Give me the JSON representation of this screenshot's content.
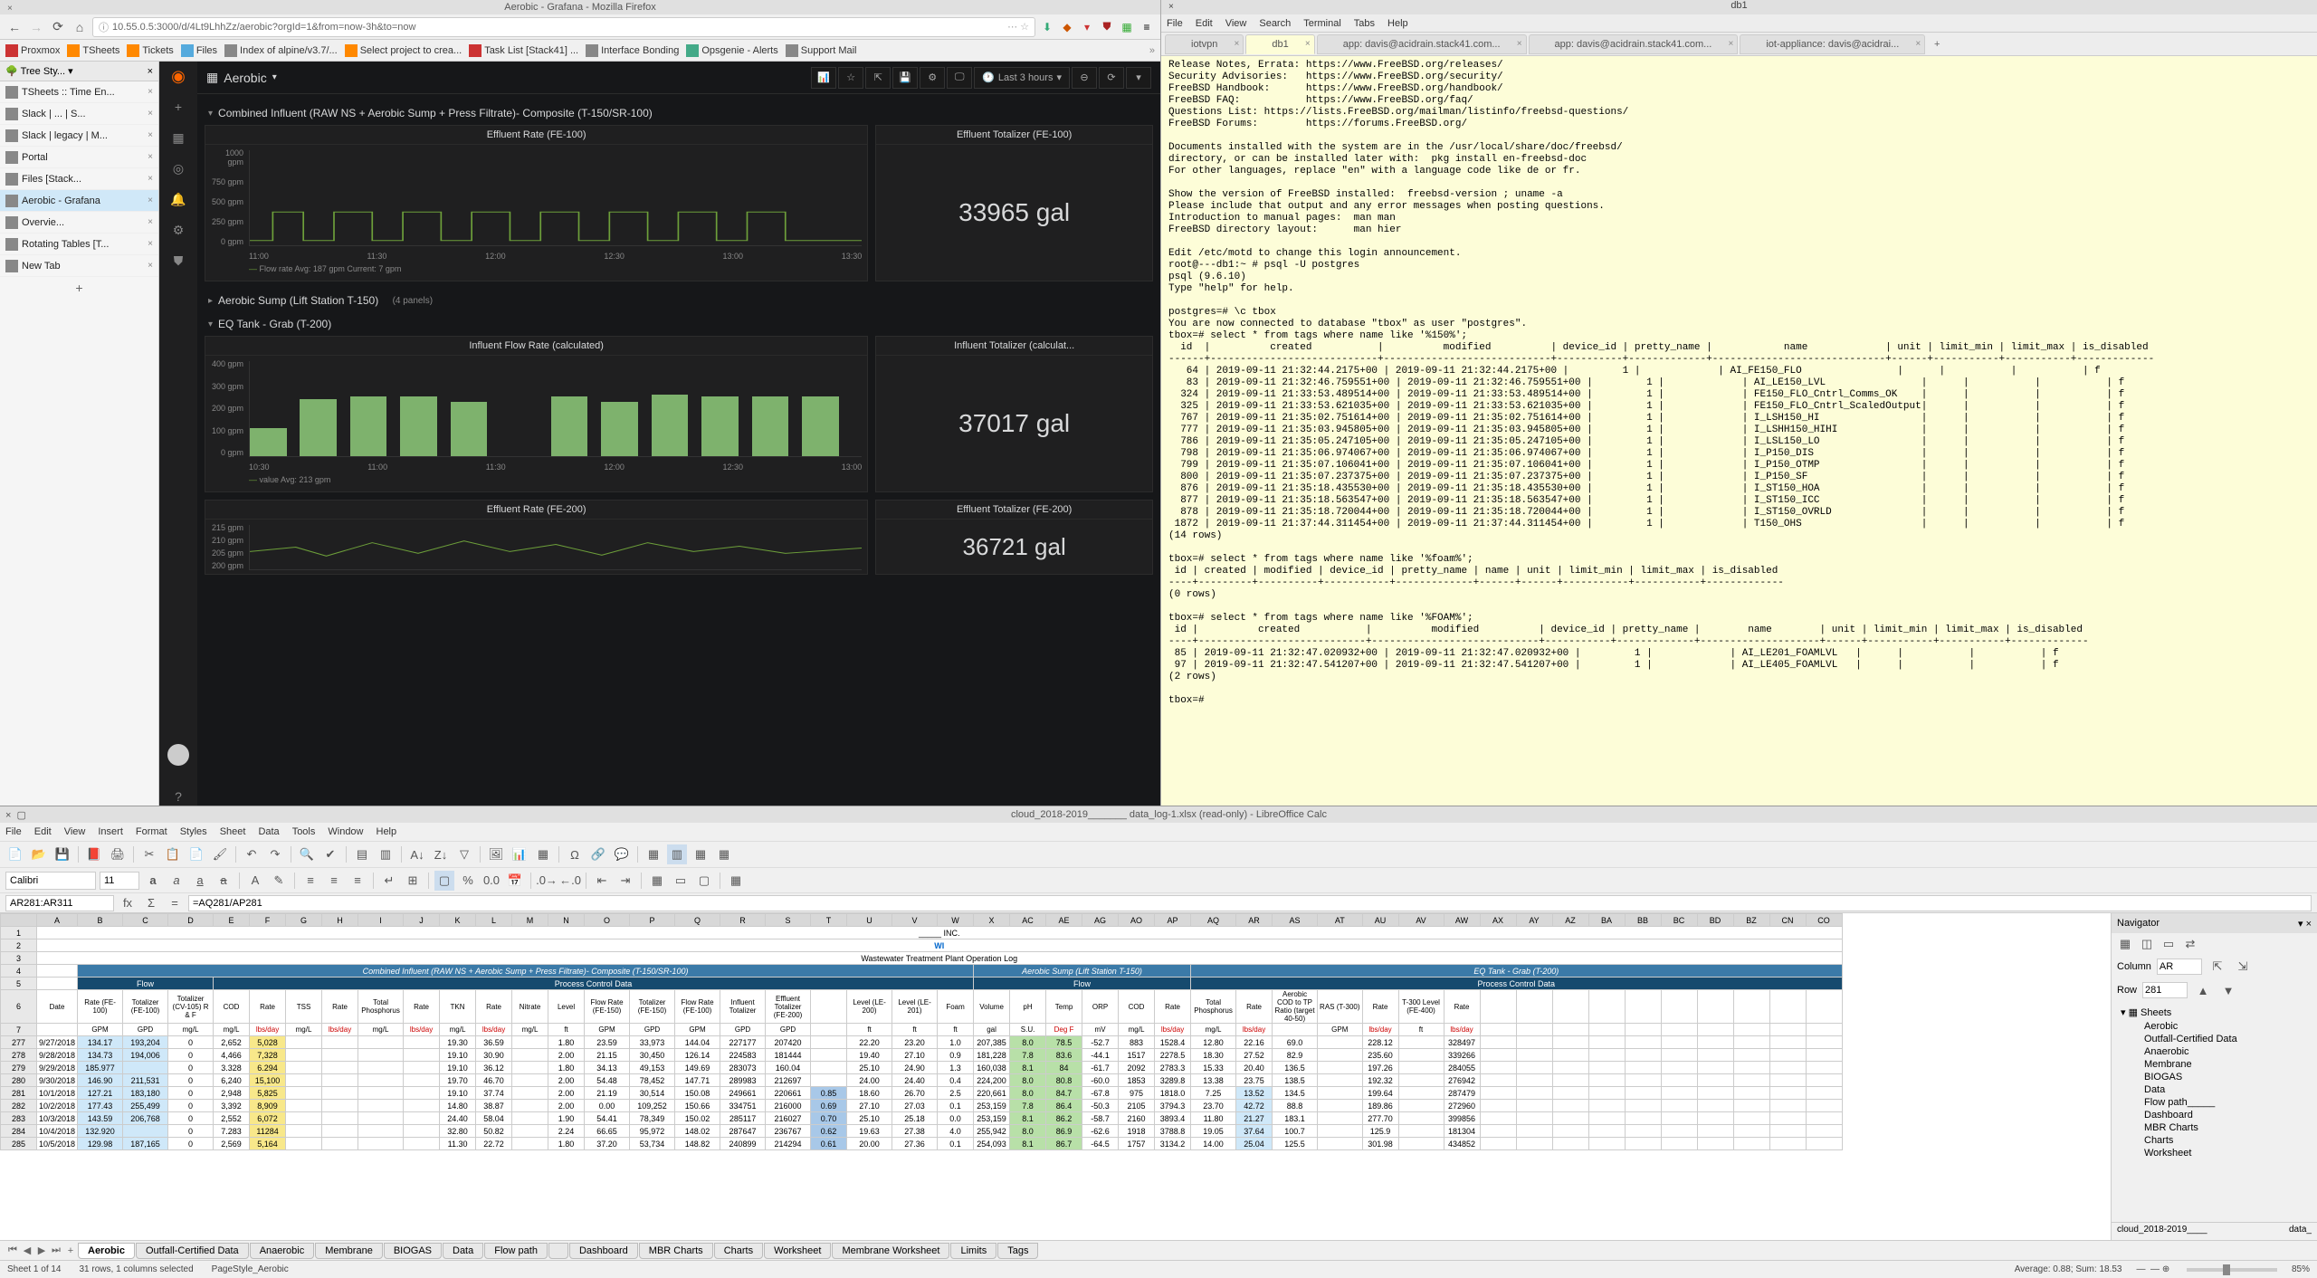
{
  "firefox": {
    "window_title": "Aerobic - Grafana - Mozilla Firefox",
    "url": "10.55.0.5:3000/d/4Lt9LhhZz/aerobic?orgId=1&from=now-3h&to=now",
    "bookmarks": [
      "Proxmox",
      "TSheets",
      "Tickets",
      "Files",
      "Index of alpine/v3.7/...",
      "Select project to crea...",
      "Task List [Stack41] ...",
      "Interface Bonding",
      "Opsgenie - Alerts",
      "Support Mail"
    ],
    "tree_title": "Tree Sty...",
    "tabs": [
      {
        "label": "TSheets :: Time En..."
      },
      {
        "label": "Slack | ... | S..."
      },
      {
        "label": "Slack | legacy | M..."
      },
      {
        "label": "Portal"
      },
      {
        "label": "Files [Stack..."
      },
      {
        "label": "Aerobic - Grafana",
        "active": true
      },
      {
        "label": "Overvie..."
      },
      {
        "label": "Rotating Tables [T..."
      },
      {
        "label": "New Tab"
      }
    ]
  },
  "grafana": {
    "title": "Aerobic",
    "time_range": "Last 3 hours",
    "rows": [
      {
        "title": "Combined Influent (RAW NS + Aerobic Sump + Press Filtrate)- Composite (T-150/SR-100)"
      },
      {
        "title": "Aerobic Sump (Lift Station T-150)",
        "panels": "(4 panels)"
      },
      {
        "title": "EQ Tank - Grab (T-200)"
      }
    ],
    "panels": {
      "eff_rate_100": {
        "title": "Effluent Rate (FE-100)",
        "legend": "Flow rate  Avg: 187 gpm  Current: 7 gpm"
      },
      "eff_tot_100": {
        "title": "Effluent Totalizer (FE-100)",
        "value": "33965 gal"
      },
      "infl_rate": {
        "title": "Influent Flow Rate (calculated)",
        "legend": "value  Avg: 213 gpm"
      },
      "infl_tot": {
        "title": "Influent Totalizer (calculat...",
        "value": "37017 gal"
      },
      "eff_rate_200": {
        "title": "Effluent Rate (FE-200)"
      },
      "eff_tot_200": {
        "title": "Effluent Totalizer (FE-200)",
        "value": "36721 gal"
      }
    }
  },
  "chart_data": [
    {
      "type": "line",
      "title": "Effluent Rate (FE-100)",
      "ylabel": "gpm",
      "ylim": [
        0,
        1000
      ],
      "yticks": [
        "1000 gpm",
        "750 gpm",
        "500 gpm",
        "250 gpm",
        "0 gpm"
      ],
      "xticks": [
        "11:00",
        "11:30",
        "12:00",
        "12:30",
        "13:00",
        "13:30"
      ],
      "series": [
        {
          "name": "Flow rate",
          "avg": 187,
          "current": 7
        }
      ]
    },
    {
      "type": "bar",
      "title": "Influent Flow Rate (calculated)",
      "ylabel": "gpm",
      "ylim": [
        0,
        400
      ],
      "yticks": [
        "400 gpm",
        "300 gpm",
        "200 gpm",
        "100 gpm",
        "0 gpm"
      ],
      "xticks": [
        "10:30",
        "11:00",
        "11:30",
        "12:00",
        "12:30",
        "13:00"
      ],
      "categories": [
        "10:30",
        "10:45",
        "11:00",
        "11:15",
        "11:30",
        "11:45",
        "12:00",
        "12:15",
        "12:30",
        "12:45",
        "13:00",
        "13:15"
      ],
      "values": [
        120,
        240,
        250,
        250,
        230,
        0,
        250,
        230,
        260,
        250,
        250,
        250
      ],
      "series": [
        {
          "name": "value",
          "avg": 213
        }
      ]
    },
    {
      "type": "line",
      "title": "Effluent Rate (FE-200)",
      "ylabel": "gpm",
      "yticks": [
        "215 gpm",
        "210 gpm",
        "205 gpm",
        "200 gpm"
      ]
    }
  ],
  "terminal": {
    "window_title": "db1",
    "menu": [
      "File",
      "Edit",
      "View",
      "Search",
      "Terminal",
      "Tabs",
      "Help"
    ],
    "tabs": [
      {
        "label": "iotvpn"
      },
      {
        "label": "db1",
        "active": true
      },
      {
        "label": "app: davis@acidrain.stack41.com..."
      },
      {
        "label": "app: davis@acidrain.stack41.com..."
      },
      {
        "label": "iot-appliance: davis@acidrai..."
      }
    ],
    "body": "Release Notes, Errata: https://www.FreeBSD.org/releases/\nSecurity Advisories:   https://www.FreeBSD.org/security/\nFreeBSD Handbook:      https://www.FreeBSD.org/handbook/\nFreeBSD FAQ:           https://www.FreeBSD.org/faq/\nQuestions List: https://lists.FreeBSD.org/mailman/listinfo/freebsd-questions/\nFreeBSD Forums:        https://forums.FreeBSD.org/\n\nDocuments installed with the system are in the /usr/local/share/doc/freebsd/\ndirectory, or can be installed later with:  pkg install en-freebsd-doc\nFor other languages, replace \"en\" with a language code like de or fr.\n\nShow the version of FreeBSD installed:  freebsd-version ; uname -a\nPlease include that output and any error messages when posting questions.\nIntroduction to manual pages:  man man\nFreeBSD directory layout:      man hier\n\nEdit /etc/motd to change this login announcement.\nroot@---db1:~ # psql -U postgres\npsql (9.6.10)\nType \"help\" for help.\n\npostgres=# \\c tbox\nYou are now connected to database \"tbox\" as user \"postgres\".\ntbox=# select * from tags where name like '%150%';\n  id  |          created           |          modified          | device_id | pretty_name |            name             | unit | limit_min | limit_max | is_disabled\n------+----------------------------+----------------------------+-----------+-------------+-----------------------------+------+-----------+-----------+-------------\n   64 | 2019-09-11 21:32:44.2175+00 | 2019-09-11 21:32:44.2175+00 |         1 |             | AI_FE150_FLO                |      |           |           | f\n   83 | 2019-09-11 21:32:46.759551+00 | 2019-09-11 21:32:46.759551+00 |         1 |             | AI_LE150_LVL                |      |           |           | f\n  324 | 2019-09-11 21:33:53.489514+00 | 2019-09-11 21:33:53.489514+00 |         1 |             | FE150_FLO_Cntrl_Comms_OK    |      |           |           | f\n  325 | 2019-09-11 21:33:53.621035+00 | 2019-09-11 21:33:53.621035+00 |         1 |             | FE150_FLO_Cntrl_ScaledOutput|      |           |           | f\n  767 | 2019-09-11 21:35:02.751614+00 | 2019-09-11 21:35:02.751614+00 |         1 |             | I_LSH150_HI                 |      |           |           | f\n  777 | 2019-09-11 21:35:03.945805+00 | 2019-09-11 21:35:03.945805+00 |         1 |             | I_LSHH150_HIHI              |      |           |           | f\n  786 | 2019-09-11 21:35:05.247105+00 | 2019-09-11 21:35:05.247105+00 |         1 |             | I_LSL150_LO                 |      |           |           | f\n  798 | 2019-09-11 21:35:06.974067+00 | 2019-09-11 21:35:06.974067+00 |         1 |             | I_P150_DIS                  |      |           |           | f\n  799 | 2019-09-11 21:35:07.106041+00 | 2019-09-11 21:35:07.106041+00 |         1 |             | I_P150_OTMP                 |      |           |           | f\n  800 | 2019-09-11 21:35:07.237375+00 | 2019-09-11 21:35:07.237375+00 |         1 |             | I_P150_SF                   |      |           |           | f\n  876 | 2019-09-11 21:35:18.435530+00 | 2019-09-11 21:35:18.435530+00 |         1 |             | I_ST150_HOA                 |      |           |           | f\n  877 | 2019-09-11 21:35:18.563547+00 | 2019-09-11 21:35:18.563547+00 |         1 |             | I_ST150_ICC                 |      |           |           | f\n  878 | 2019-09-11 21:35:18.720044+00 | 2019-09-11 21:35:18.720044+00 |         1 |             | I_ST150_OVRLD               |      |           |           | f\n 1872 | 2019-09-11 21:37:44.311454+00 | 2019-09-11 21:37:44.311454+00 |         1 |             | T150_OHS                    |      |           |           | f\n(14 rows)\n\ntbox=# select * from tags where name like '%foam%';\n id | created | modified | device_id | pretty_name | name | unit | limit_min | limit_max | is_disabled\n----+---------+----------+-----------+-------------+------+------+-----------+-----------+-------------\n(0 rows)\n\ntbox=# select * from tags where name like '%FOAM%';\n id |          created           |          modified          | device_id | pretty_name |        name        | unit | limit_min | limit_max | is_disabled\n----+----------------------------+----------------------------+-----------+-------------+--------------------+------+-----------+-----------+-------------\n 85 | 2019-09-11 21:32:47.020932+00 | 2019-09-11 21:32:47.020932+00 |         1 |             | AI_LE201_FOAMLVL   |      |           |           | f\n 97 | 2019-09-11 21:32:47.541207+00 | 2019-09-11 21:32:47.541207+00 |         1 |             | AI_LE405_FOAMLVL   |      |           |           | f\n(2 rows)\n\ntbox=# "
  },
  "libre": {
    "window_title": "cloud_2018-2019_______ data_log-1.xlsx (read-only) - LibreOffice Calc",
    "menu": [
      "File",
      "Edit",
      "View",
      "Insert",
      "Format",
      "Styles",
      "Sheet",
      "Data",
      "Tools",
      "Window",
      "Help"
    ],
    "font": "Calibri",
    "size": "11",
    "cell_ref": "AR281:AR311",
    "formula": "=AQ281/AP281",
    "col_heads": [
      "A",
      "B",
      "C",
      "D",
      "E",
      "F",
      "G",
      "H",
      "I",
      "J",
      "K",
      "L",
      "M",
      "N",
      "O",
      "P",
      "Q",
      "R",
      "S",
      "T",
      "U",
      "V",
      "W",
      "X",
      "AC",
      "AE",
      "AG",
      "AO",
      "AP",
      "AQ",
      "AR",
      "AS",
      "AT",
      "AU",
      "AV",
      "AW",
      "AX",
      "AY",
      "AZ",
      "BA",
      "BB",
      "BC",
      "BD",
      "BZ",
      "CN",
      "CO"
    ],
    "row_heads": [
      "1",
      "2",
      "3",
      "4",
      "5",
      "6",
      "7",
      "277",
      "278",
      "279",
      "280",
      "281",
      "282",
      "283",
      "284",
      "285"
    ],
    "title_row": "_____ INC.",
    "subtitle": "WI",
    "subtitle2": "Wastewater Treatment Plant Operation Log",
    "section1": "Combined Influent (RAW NS + Aerobic Sump + Press Filtrate)- Composite (T-150/SR-100)",
    "section2": "Aerobic Sump (Lift Station T-150)",
    "section3": "EQ Tank - Grab (T-200)",
    "sub_flow": "Flow",
    "sub_pcd": "Process Control Data",
    "col_labels_r1": [
      "Date",
      "Rate (FE-100)",
      "Totalizer (FE-100)",
      "Totalizer (CV-105) R & F",
      "COD",
      "Rate",
      "TSS",
      "Rate",
      "Total Phosphorus",
      "Rate",
      "TKN",
      "Rate",
      "Nitrate",
      "Level",
      "Flow Rate (FE-150)",
      "Totalizer (FE-150)",
      "Flow Rate (FE-100)",
      "Influent Totalizer",
      "Effluent Totalizer (FE-200)",
      "",
      "Level (LE-200)",
      "Level (LE-201)",
      "Foam",
      "Volume",
      "pH",
      "Temp",
      "ORP",
      "COD",
      "Rate",
      "Total Phosphorus",
      "Rate",
      "Aerobic COD to TP Ratio (target 40-50)",
      "RAS (T-300)",
      "Rate",
      "T-300 Level (FE-400)",
      "Rate"
    ],
    "col_units": [
      "",
      "GPM",
      "GPD",
      "mg/L",
      "mg/L",
      "lbs/day",
      "mg/L",
      "lbs/day",
      "mg/L",
      "lbs/day",
      "mg/L",
      "lbs/day",
      "mg/L",
      "ft",
      "GPM",
      "GPD",
      "GPM",
      "GPD",
      "GPD",
      "",
      "ft",
      "ft",
      "ft",
      "gal",
      "S.U.",
      "Deg F",
      "mV",
      "mg/L",
      "lbs/day",
      "mg/L",
      "lbs/day",
      "",
      "GPM",
      "lbs/day",
      "ft",
      "lbs/day"
    ],
    "data_rows": [
      [
        "9/27/2018",
        "134.17",
        "193,204",
        "0",
        "2,652",
        "5,028",
        "",
        "",
        "",
        "",
        "19.30",
        "36.59",
        "",
        "1.80",
        "23.59",
        "33,973",
        "144.04",
        "227177",
        "207420",
        "",
        "22.20",
        "23.20",
        "1.0",
        "207,385",
        "8.0",
        "78.5",
        "-52.7",
        "883",
        "1528.4",
        "12.80",
        "22.16",
        "69.0",
        "",
        "228.12",
        "",
        "328497"
      ],
      [
        "9/28/2018",
        "134.73",
        "194,006",
        "0",
        "4,466",
        "7,328",
        "",
        "",
        "",
        "",
        "19.10",
        "30.90",
        "",
        "2.00",
        "21.15",
        "30,450",
        "126.14",
        "224583",
        "181444",
        "",
        "19.40",
        "27.10",
        "0.9",
        "181,228",
        "7.8",
        "83.6",
        "-44.1",
        "1517",
        "2278.5",
        "18.30",
        "27.52",
        "82.9",
        "",
        "235.60",
        "",
        "339266"
      ],
      [
        "9/29/2018",
        "185.977",
        "",
        "0",
        "3.328",
        "6.294",
        "",
        "",
        "",
        "",
        "19.10",
        "36.12",
        "",
        "1.80",
        "34.13",
        "49,153",
        "149.69",
        "283073",
        "160.04",
        "",
        "25.10",
        "24.90",
        "1.3",
        "160,038",
        "8.1",
        "84",
        "-61.7",
        "2092",
        "2783.3",
        "15.33",
        "20.40",
        "136.5",
        "",
        "197.26",
        "",
        "284055"
      ],
      [
        "9/30/2018",
        "146.90",
        "211,531",
        "0",
        "6,240",
        "15,100",
        "",
        "",
        "",
        "",
        "19.70",
        "46.70",
        "",
        "2.00",
        "54.48",
        "78,452",
        "147.71",
        "289983",
        "212697",
        "",
        "24.00",
        "24.40",
        "0.4",
        "224,200",
        "8.0",
        "80.8",
        "-60.0",
        "1853",
        "3289.8",
        "13.38",
        "23.75",
        "138.5",
        "",
        "192.32",
        "",
        "276942"
      ],
      [
        "10/1/2018",
        "127.21",
        "183,180",
        "0",
        "2,948",
        "5,825",
        "",
        "",
        "",
        "",
        "19.10",
        "37.74",
        "",
        "2.00",
        "21.19",
        "30,514",
        "150.08",
        "249661",
        "220661",
        "0.85",
        "18.60",
        "26.70",
        "2.5",
        "220,661",
        "8.0",
        "84.7",
        "-67.8",
        "975",
        "1818.0",
        "7.25",
        "13.52",
        "134.5",
        "",
        "199.64",
        "",
        "287479"
      ],
      [
        "10/2/2018",
        "177.43",
        "255,499",
        "0",
        "3,392",
        "8,909",
        "",
        "",
        "",
        "",
        "14.80",
        "38.87",
        "",
        "2.00",
        "0.00",
        "109,252",
        "150.66",
        "334751",
        "216000",
        "0.69",
        "27.10",
        "27.03",
        "0.1",
        "253,159",
        "7.8",
        "86.4",
        "-50.3",
        "2105",
        "3794.3",
        "23.70",
        "42.72",
        "88.8",
        "",
        "189.86",
        "",
        "272960"
      ],
      [
        "10/3/2018",
        "143.59",
        "206,768",
        "0",
        "2,552",
        "6,072",
        "",
        "",
        "",
        "",
        "24.40",
        "58.04",
        "",
        "1.90",
        "54.41",
        "78,349",
        "150.02",
        "285117",
        "216027",
        "0.70",
        "25.10",
        "25.18",
        "0.0",
        "253,159",
        "8.1",
        "86.2",
        "-58.7",
        "2160",
        "3893.4",
        "11.80",
        "21.27",
        "183.1",
        "",
        "277.70",
        "",
        "399856"
      ],
      [
        "10/4/2018",
        "132.920",
        "",
        "0",
        "7.283",
        "11284",
        "",
        "",
        "",
        "",
        "32.80",
        "50.82",
        "",
        "2.24",
        "66.65",
        "95,972",
        "148.02",
        "287647",
        "236767",
        "0.62",
        "19.63",
        "27.38",
        "4.0",
        "255,942",
        "8.0",
        "86.9",
        "-62.6",
        "1918",
        "3788.8",
        "19.05",
        "37.64",
        "100.7",
        "",
        "125.9",
        "",
        "181304"
      ],
      [
        "10/5/2018",
        "129.98",
        "187,165",
        "0",
        "2,569",
        "5,164",
        "",
        "",
        "",
        "",
        "11.30",
        "22.72",
        "",
        "1.80",
        "37.20",
        "53,734",
        "148.82",
        "240899",
        "214294",
        "0.61",
        "20.00",
        "27.36",
        "0.1",
        "254,093",
        "8.1",
        "86.7",
        "-64.5",
        "1757",
        "3134.2",
        "14.00",
        "25.04",
        "125.5",
        "",
        "301.98",
        "",
        "434852"
      ]
    ],
    "sheet_tabs": [
      "Aerobic",
      "Outfall-Certified Data",
      "Anaerobic",
      "Membrane",
      "BIOGAS",
      "Data",
      "Flow path",
      "",
      "Dashboard",
      "MBR Charts",
      "Charts",
      "Worksheet",
      "Membrane Worksheet",
      "Limits",
      "Tags"
    ],
    "active_sheet": "Aerobic",
    "status": {
      "sheet": "Sheet 1 of 14",
      "sel": "31 rows, 1 columns selected",
      "style": "PageStyle_Aerobic",
      "avg": "Average: 0.88; Sum: 18.53",
      "zoom": "85%"
    },
    "navigator": {
      "title": "Navigator",
      "column": "AR",
      "row": "281",
      "sheets_label": "Sheets",
      "items": [
        "Aerobic",
        "Outfall-Certified Data",
        "Anaerobic",
        "Membrane",
        "BIOGAS",
        "Data",
        "Flow path_____",
        "Dashboard",
        "MBR Charts",
        "Charts",
        "Worksheet"
      ],
      "footer_left": "cloud_2018-2019____",
      "footer_right": "data_"
    }
  }
}
